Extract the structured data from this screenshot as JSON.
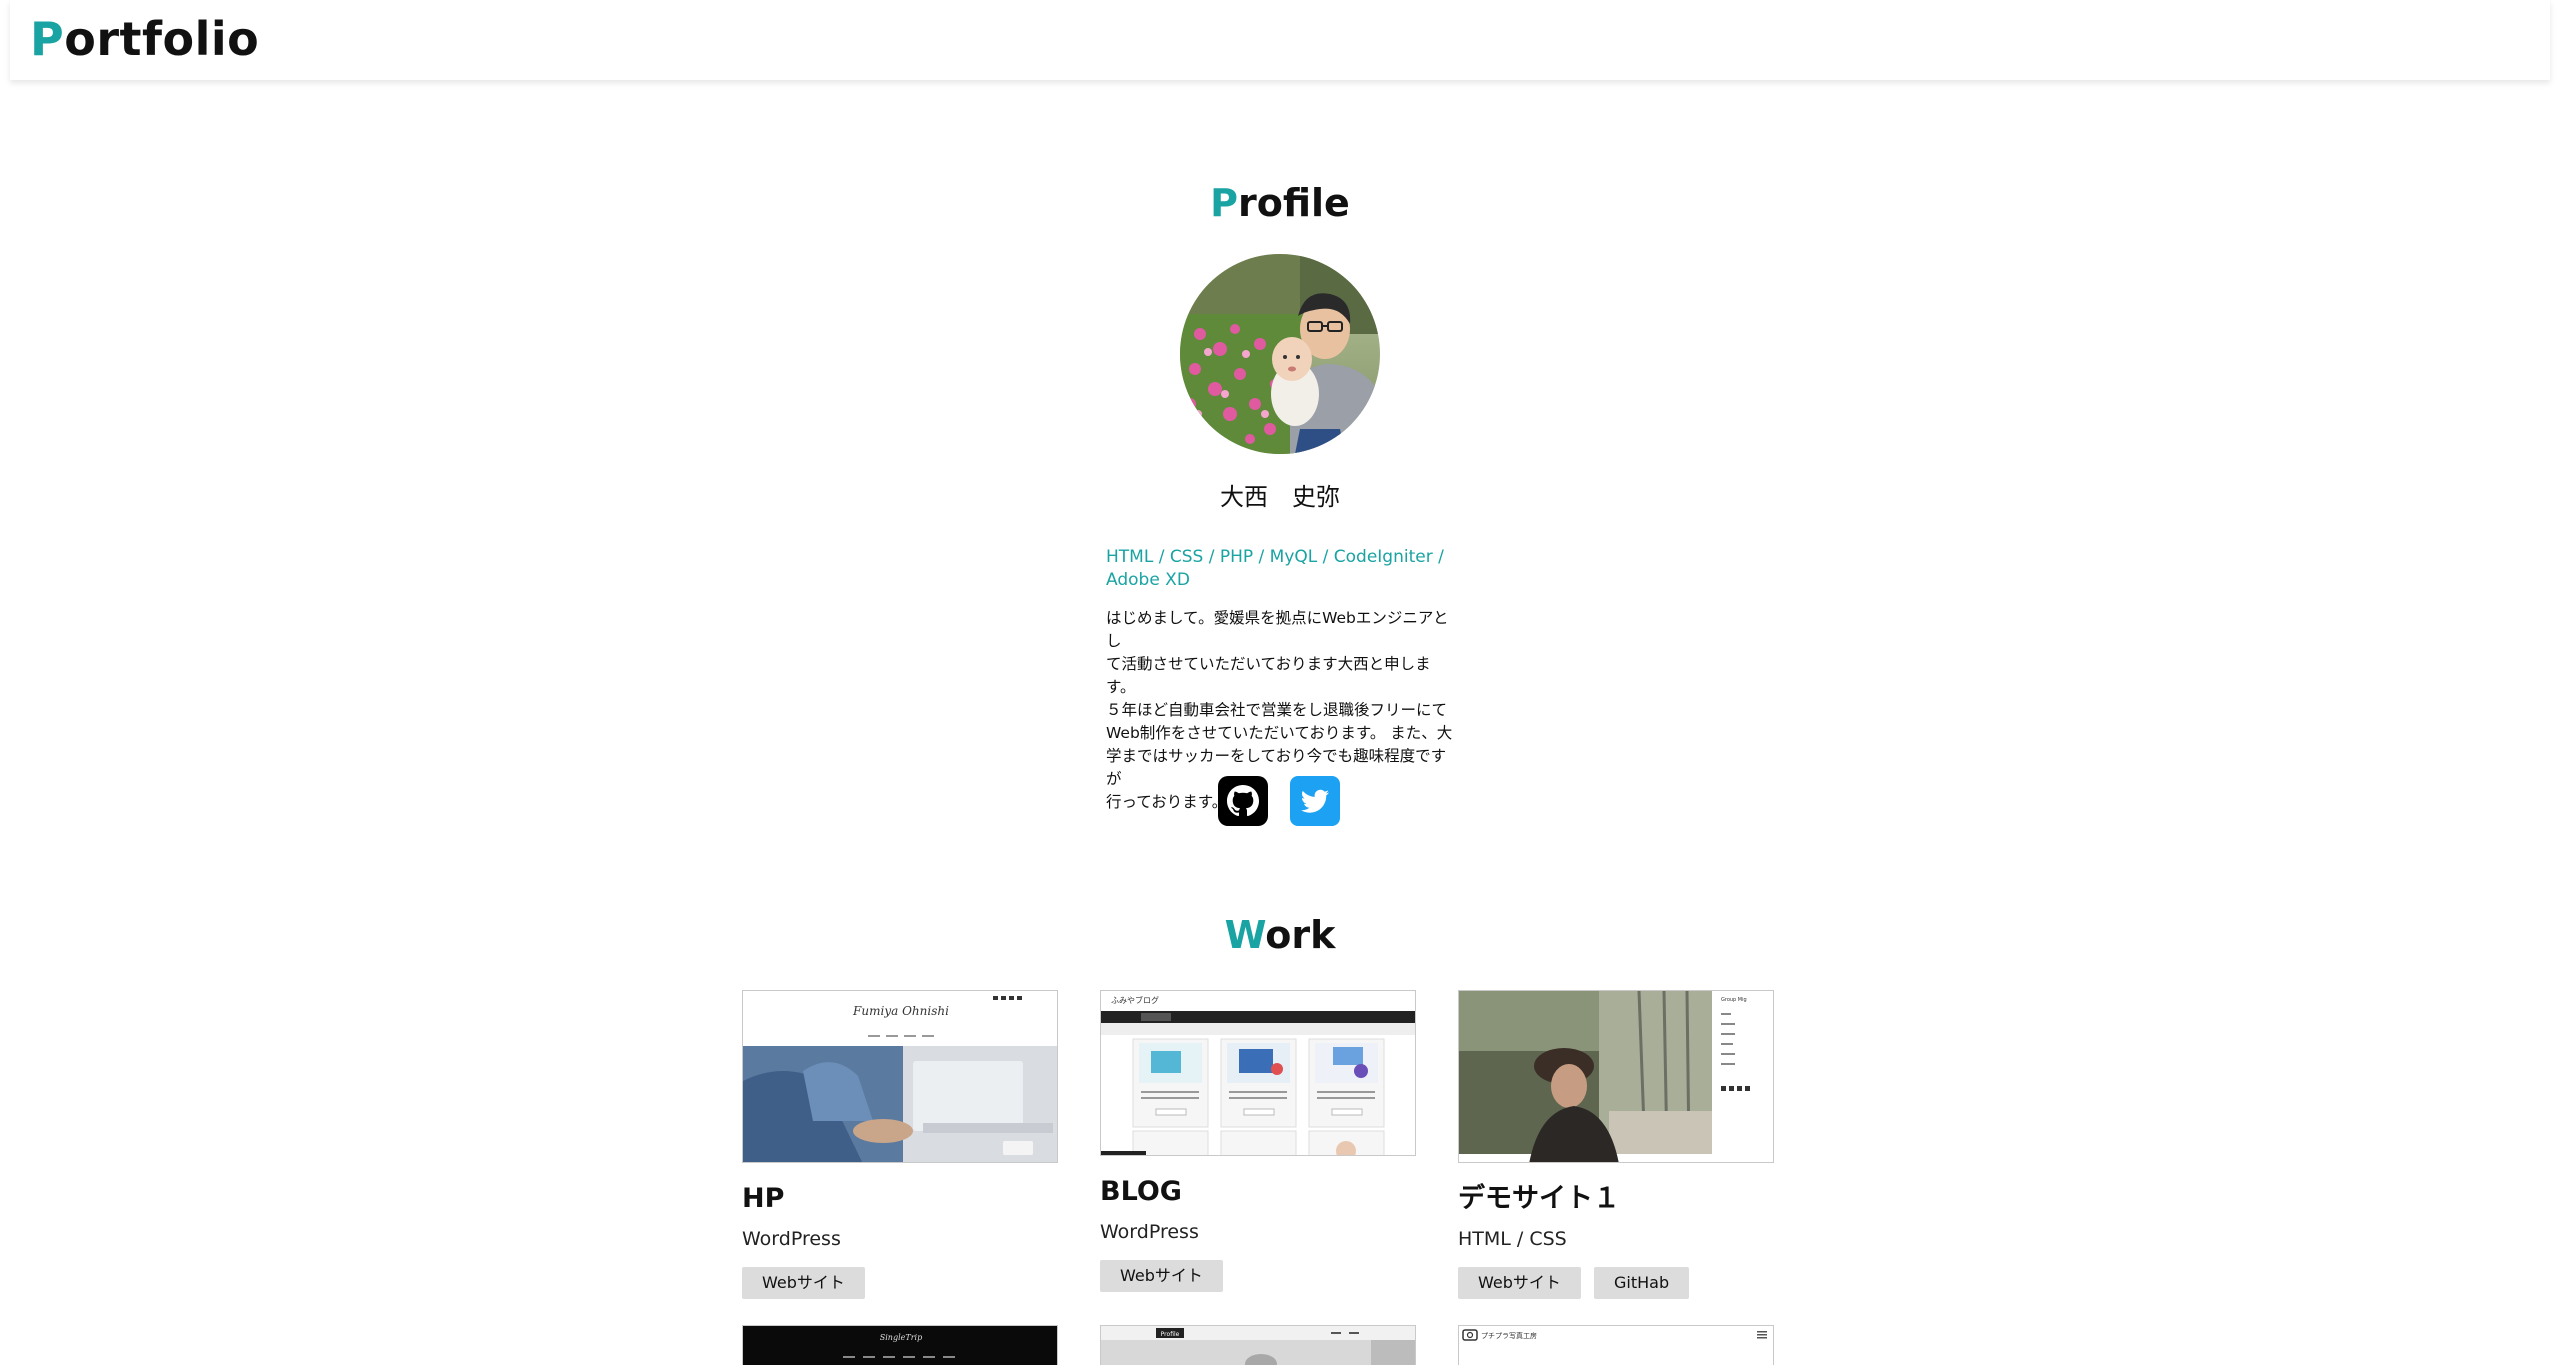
{
  "header": {
    "logo_initial": "P",
    "logo_rest": "ortfolio"
  },
  "profile": {
    "title_initial": "P",
    "title_rest": "rofile",
    "avatar": "profile-photo",
    "name": "大西　史弥",
    "skills": [
      "HTML",
      "CSS",
      "PHP",
      "MyQL",
      "CodeIgniter",
      "Adobe XD"
    ],
    "skills_line1": "HTML / CSS / PHP / MyQL / CodeIgniter /",
    "skills_line2": "Adobe XD",
    "bio_lines": [
      "はじめまして。愛媛県を拠点にWebエンジニアとし",
      "て活動させていただいております大西と申します。",
      "５年ほど自動車会社で営業をし退職後フリーにて",
      "Web制作をさせていただいております。 また、大",
      "学まではサッカーをしており今でも趣味程度ですが",
      "行っております。"
    ],
    "social": [
      {
        "icon": "github-icon",
        "color": "#000000"
      },
      {
        "icon": "twitter-icon",
        "color": "#1da1f2"
      }
    ]
  },
  "work": {
    "title_initial": "W",
    "title_rest": "ork",
    "items": [
      {
        "title": "HP",
        "subtitle": "WordPress",
        "tags": [
          "Webサイト"
        ],
        "thumb_site_name": "Fumiya Ohnishi"
      },
      {
        "title": "BLOG",
        "subtitle": "WordPress",
        "tags": [
          "Webサイト"
        ],
        "thumb_site_name": "ふみやブログ"
      },
      {
        "title": "デモサイト１",
        "subtitle": "HTML / CSS",
        "tags": [
          "Webサイト",
          "GitHab"
        ],
        "thumb_site_name": "Group Mig"
      }
    ],
    "next_row": [
      {
        "thumb_site_name": "SingleTrip"
      },
      {
        "thumb_site_name": "Profile"
      },
      {
        "thumb_site_name": "プチプラ写真工房"
      }
    ]
  },
  "colors": {
    "accent": "#1aa3a3",
    "tag_bg": "#dcdcdc",
    "twitter": "#1da1f2"
  }
}
